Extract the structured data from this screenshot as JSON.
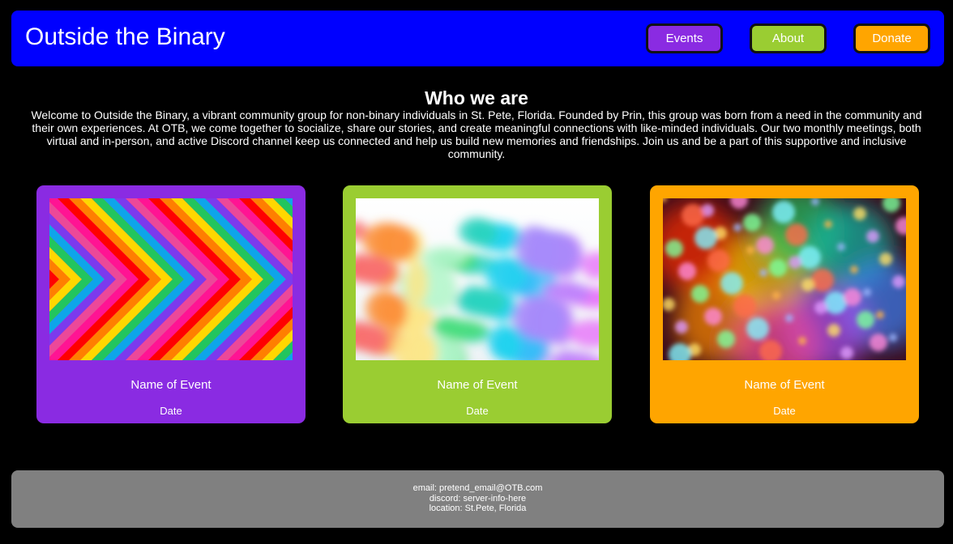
{
  "header": {
    "title": "Outside the Binary",
    "nav": {
      "events_label": "Events",
      "about_label": "About",
      "donate_label": "Donate"
    }
  },
  "about": {
    "heading": "Who we are",
    "text": "Welcome to Outside the Binary, a vibrant community group for non-binary individuals in St. Pete, Florida. Founded by Prin, this group was born from a need in the community and their own experiences. At OTB, we come together to socialize, share our stories, and create meaningful connections with like-minded individuals. Our two monthly meetings, both virtual and in-person, and active Discord channel keep us connected and help us build new memories and friendships. Join us and be a part of this supportive and inclusive community."
  },
  "events": [
    {
      "name": "Name of Event",
      "date": "Date",
      "image": "rainbow-chevron-stripes",
      "color": "#8a2be2"
    },
    {
      "name": "Name of Event",
      "date": "Date",
      "image": "rainbow-ink-clouds",
      "color": "#9acd32"
    },
    {
      "name": "Name of Event",
      "date": "Date",
      "image": "rainbow-bokeh-lights",
      "color": "#ffa500"
    }
  ],
  "footer": {
    "email": "email: pretend_email@OTB.com",
    "discord": "discord: server-info-here",
    "location": "location: St.Pete, Florida"
  },
  "colors": {
    "header_bg": "#0000ff",
    "page_bg": "#000000",
    "footer_bg": "#808080",
    "purple": "#8a2be2",
    "green": "#9acd32",
    "orange": "#ffa500"
  }
}
